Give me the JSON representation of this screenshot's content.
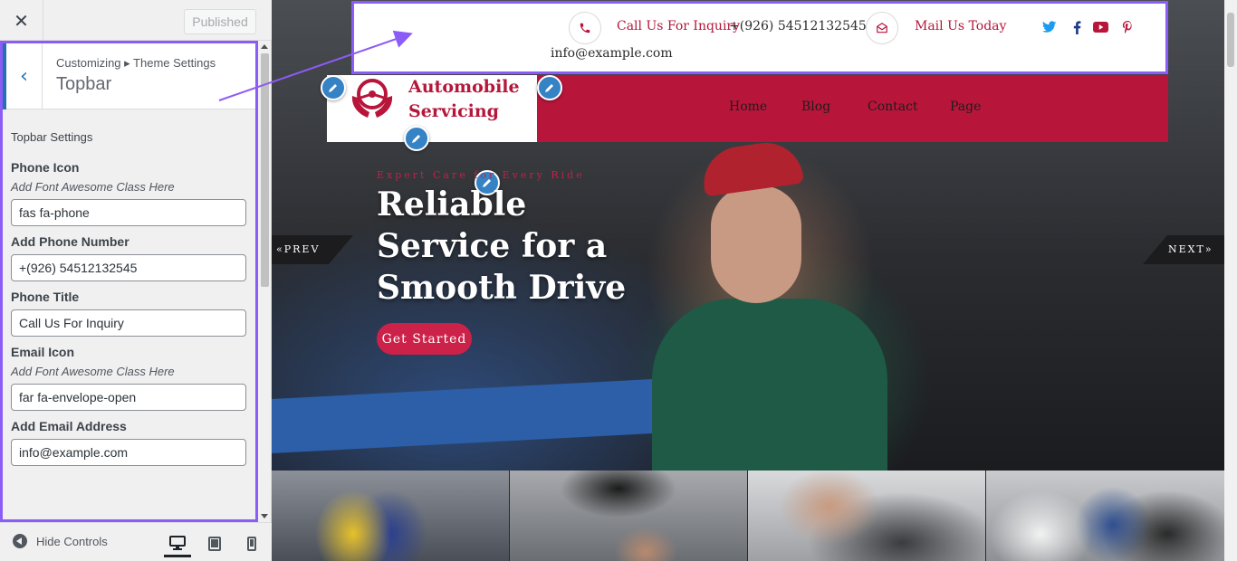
{
  "customizer": {
    "close_icon": "close-icon",
    "published_label": "Published",
    "breadcrumb": "Customizing ▸ Theme Settings",
    "section_title": "Topbar",
    "settings_heading": "Topbar Settings",
    "controls": [
      {
        "title": "Phone Icon",
        "description": "Add Font Awesome Class Here",
        "value": "fas fa-phone"
      },
      {
        "title": "Add Phone Number",
        "description": "",
        "value": "+(926) 54512132545"
      },
      {
        "title": "Phone Title",
        "description": "",
        "value": "Call Us For Inquiry"
      },
      {
        "title": "Email Icon",
        "description": "Add Font Awesome Class Here",
        "value": "far fa-envelope-open"
      },
      {
        "title": "Add Email Address",
        "description": "",
        "value": "info@example.com"
      }
    ],
    "footer": {
      "hide_controls_label": "Hide Controls"
    }
  },
  "site": {
    "topbar": {
      "phone_title": "Call Us For Inquiry",
      "phone_number": "+(926) 54512132545",
      "email_title": "Mail Us Today",
      "email_address": "info@example.com",
      "socials": [
        "twitter-icon",
        "facebook-icon",
        "youtube-icon",
        "pinterest-icon"
      ]
    },
    "logo": {
      "line1": "Automobile",
      "line2": "Servicing"
    },
    "nav": [
      "Home",
      "Blog",
      "Contact",
      "Page"
    ],
    "hero": {
      "tagline": "Expert Care for Every Ride",
      "heading": "Reliable Service for a Smooth Drive",
      "button": "Get Started",
      "prev": "«PREV",
      "next": "NEXT»"
    }
  },
  "colors": {
    "brand_red": "#b8153a",
    "accent_purple": "#8b5cf6",
    "wp_blue": "#2271b1"
  }
}
